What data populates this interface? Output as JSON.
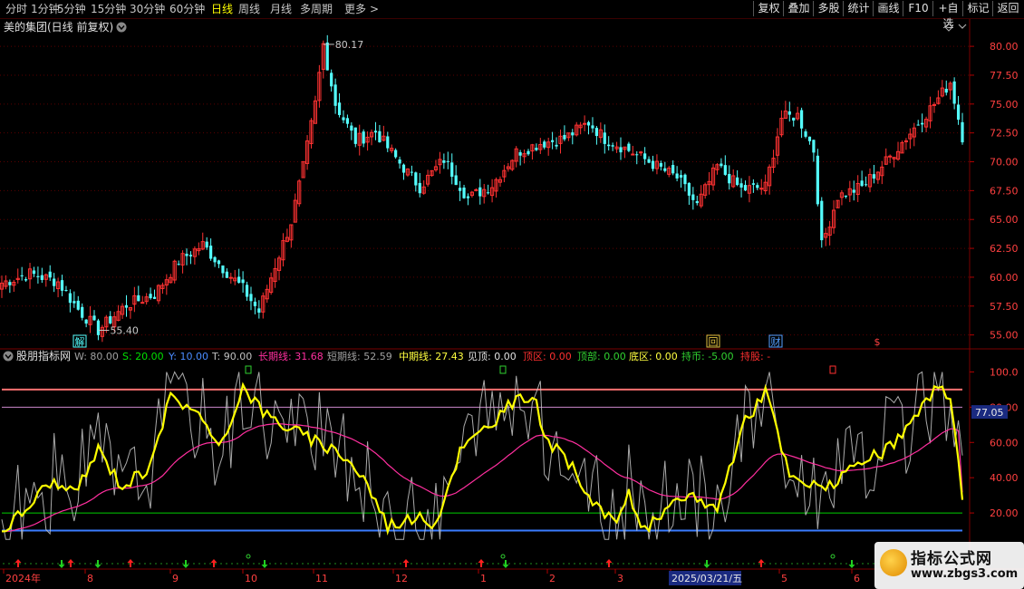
{
  "toolbar": {
    "periods": [
      "分时",
      "1分钟",
      "5分钟",
      "15分钟",
      "30分钟",
      "60分钟",
      "日线",
      "周线",
      "月线",
      "多周期",
      "更多"
    ],
    "active_period": "日线",
    "more_arrow": ">",
    "right_buttons": [
      "复权",
      "叠加",
      "多股",
      "统计",
      "画线",
      "F10",
      "+自选",
      "标记",
      "返回"
    ]
  },
  "main_panel": {
    "title": "美的集团(日线 前复权)",
    "y_ticks": [
      "80.00",
      "77.50",
      "75.00",
      "72.50",
      "70.00",
      "67.50",
      "65.00",
      "62.50",
      "60.00",
      "57.50",
      "55.00"
    ],
    "high_label": "80.17",
    "low_label": "55.40",
    "markers": [
      "解",
      "回",
      "财",
      "$"
    ]
  },
  "indicator_panel": {
    "name": "股朋指标网",
    "params": [
      {
        "label": "W: 80.00",
        "color": "#a0a0a0"
      },
      {
        "label": "S: 20.00",
        "color": "#00e000"
      },
      {
        "label": "Y: 10.00",
        "color": "#4a8cff"
      },
      {
        "label": "T: 90.00",
        "color": "#c0c0c0"
      },
      {
        "label": "长期线: 31.68",
        "color": "#ff2f9f"
      },
      {
        "label": "短期线: 52.59",
        "color": "#a0a0a0"
      },
      {
        "label": "中期线: 27.43",
        "color": "#ffff40"
      },
      {
        "label": "见顶: 0.00",
        "color": "#e0e0e0"
      },
      {
        "label": "顶区: 0.00",
        "color": "#ff3030"
      },
      {
        "label": "顶部: 0.00",
        "color": "#30d030"
      },
      {
        "label": "底区: 0.00",
        "color": "#ffff40"
      },
      {
        "label": "持币: -5.00",
        "color": "#30d030"
      },
      {
        "label": "持股: -",
        "color": "#ff3030"
      }
    ],
    "y_ticks": [
      "100.0",
      "80.00",
      "60.00",
      "40.00",
      "20.00"
    ],
    "current_value": "77.05"
  },
  "time_axis": {
    "labels": [
      "2024年",
      "8",
      "9",
      "10",
      "11",
      "12",
      "1",
      "2",
      "3",
      "2025/03/21/五",
      "5",
      "6"
    ]
  },
  "watermark": {
    "title": "指标公式网",
    "url": "www.zbgs3.com"
  },
  "colors": {
    "up": "#ff3232",
    "down": "#54ffff",
    "long_line": "#ff2f9f",
    "short_line": "#c8c8c8",
    "mid_line": "#ffff00",
    "level_90": "#ff7070",
    "level_80": "#cc88cc",
    "level_20": "#00d000",
    "level_10": "#3a7cff"
  },
  "chart_data": {
    "type": "candlestick",
    "ylim": [
      54.5,
      81.5
    ],
    "key_points": [
      {
        "label": "start",
        "value": 59.5
      },
      {
        "label": "low",
        "value": 55.4
      },
      {
        "label": "high",
        "value": 80.17
      },
      {
        "label": "dip",
        "value": 62.7
      },
      {
        "label": "late-high",
        "value": 76.9
      },
      {
        "label": "end",
        "value": 72.2
      }
    ],
    "indicator": {
      "ylim": [
        0,
        110
      ],
      "levels": [
        90,
        80,
        20,
        10
      ],
      "long_line_end": 31.68,
      "short_line_end": 52.59,
      "mid_line_end": 27.43
    }
  }
}
